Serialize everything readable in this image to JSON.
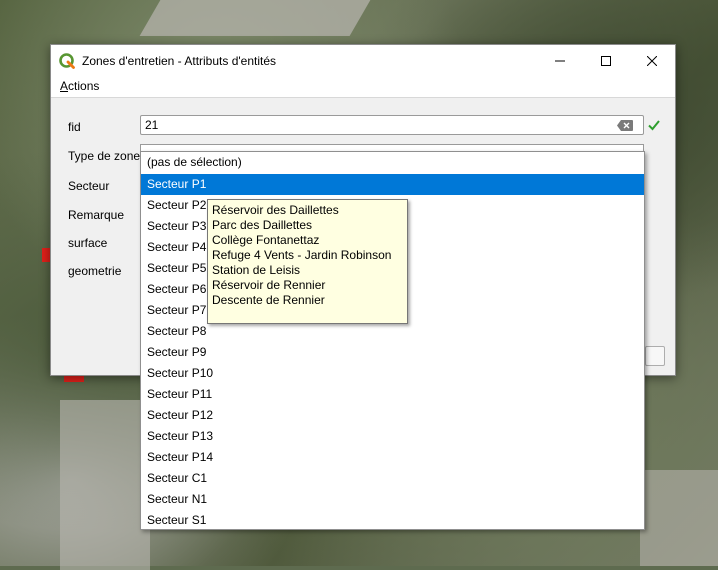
{
  "window": {
    "title": "Zones d'entretien - Attributs d'entités"
  },
  "menu": {
    "actions_first": "A",
    "actions_rest": "ctions"
  },
  "form": {
    "labels": [
      "fid",
      "Type de zone",
      "Secteur",
      "Remarque",
      "surface",
      "geometrie"
    ],
    "fid_value": "21"
  },
  "dropdown": {
    "items": [
      "(pas de sélection)",
      "Secteur P1",
      "Secteur P2",
      "Secteur P3",
      "Secteur P4",
      "Secteur P5",
      "Secteur P6",
      "Secteur P7",
      "Secteur P8",
      "Secteur P9",
      "Secteur P10",
      "Secteur P11",
      "Secteur P12",
      "Secteur P13",
      "Secteur P14",
      "Secteur C1",
      "Secteur N1",
      "Secteur S1"
    ],
    "selected_index": 1
  },
  "tooltip": {
    "lines": [
      "Réservoir des Daillettes",
      "Parc des Daillettes",
      "Collège Fontanettaz",
      "Refuge 4 Vents - Jardin Robinson",
      "Station de Leisis",
      "Réservoir de Rennier",
      "Descente de Rennier"
    ]
  },
  "colors": {
    "selection": "#0078d7",
    "tooltip_bg": "#ffffe1",
    "valid_check": "#2e9e2e"
  }
}
